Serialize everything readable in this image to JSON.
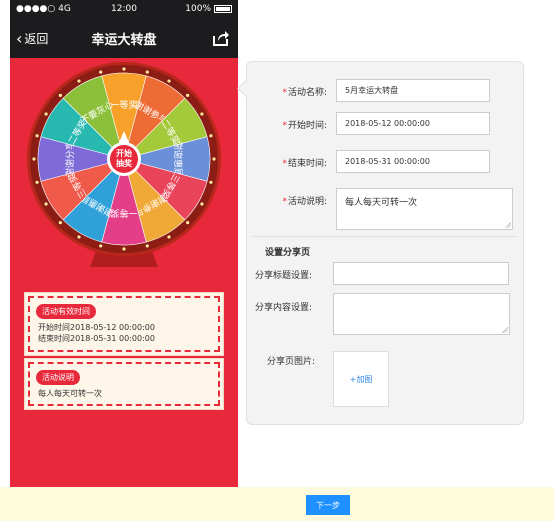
{
  "status_bar": {
    "signal": "●●●●○ 4G",
    "time": "12:00",
    "battery": "100%"
  },
  "nav": {
    "back_label": "返回",
    "title": "幸运大转盘"
  },
  "wheel": {
    "center_label": "开始抽奖",
    "segments": [
      {
        "label": "一等奖",
        "color": "#f7a12a"
      },
      {
        "label": "谢谢参与",
        "color": "#ee6b35"
      },
      {
        "label": "二等奖",
        "color": "#a4c93a"
      },
      {
        "label": "谢谢惠顾",
        "color": "#6c8fd9"
      },
      {
        "label": "三等奖",
        "color": "#e9445a"
      },
      {
        "label": "谢谢参与",
        "color": "#f0a836"
      },
      {
        "label": "一等奖",
        "color": "#e53e89"
      },
      {
        "label": "谢谢惠顾",
        "color": "#2fa1d8"
      },
      {
        "label": "三等奖",
        "color": "#f05a4b"
      },
      {
        "label": "谢谢分享",
        "color": "#7e6bd8"
      },
      {
        "label": "二等奖",
        "color": "#27b9b0"
      },
      {
        "label": "不要灰心",
        "color": "#8dc03a"
      }
    ],
    "colors": {
      "rim": "#8c1d15",
      "rim_outer": "#b8271c",
      "center": "#e8283b",
      "light": "#ffe9a0"
    }
  },
  "time_box": {
    "tag": "活动有效时间",
    "start_line": "开始时间2018-05-12 00:00:00",
    "end_line": "结束时间2018-05-31 00:00:00"
  },
  "desc_box": {
    "tag": "活动说明",
    "text": "每人每天可转一次"
  },
  "form": {
    "name_label": "活动名称:",
    "name_value": "5月幸运大转盘",
    "start_label": "开始时间:",
    "start_value": "2018-05-12 00:00:00",
    "end_label": "结束时间:",
    "end_value": "2018-05-31 00:00:00",
    "desc_label": "活动说明:",
    "desc_value": "每人每天可转一次",
    "required_mark": "*"
  },
  "share": {
    "section_title": "设置分享页",
    "title_label": "分享标题设置:",
    "title_value": "",
    "content_label": "分享内容设置:",
    "content_value": "",
    "image_label": "分享页图片:",
    "add_image": "+加图"
  },
  "footer": {
    "next_label": "下一步"
  },
  "colors": {
    "accent_red": "#e8283b",
    "primary_blue": "#1e90ff",
    "footer_bg": "#fdfbdc",
    "nav_bg": "#1c1c1e"
  }
}
